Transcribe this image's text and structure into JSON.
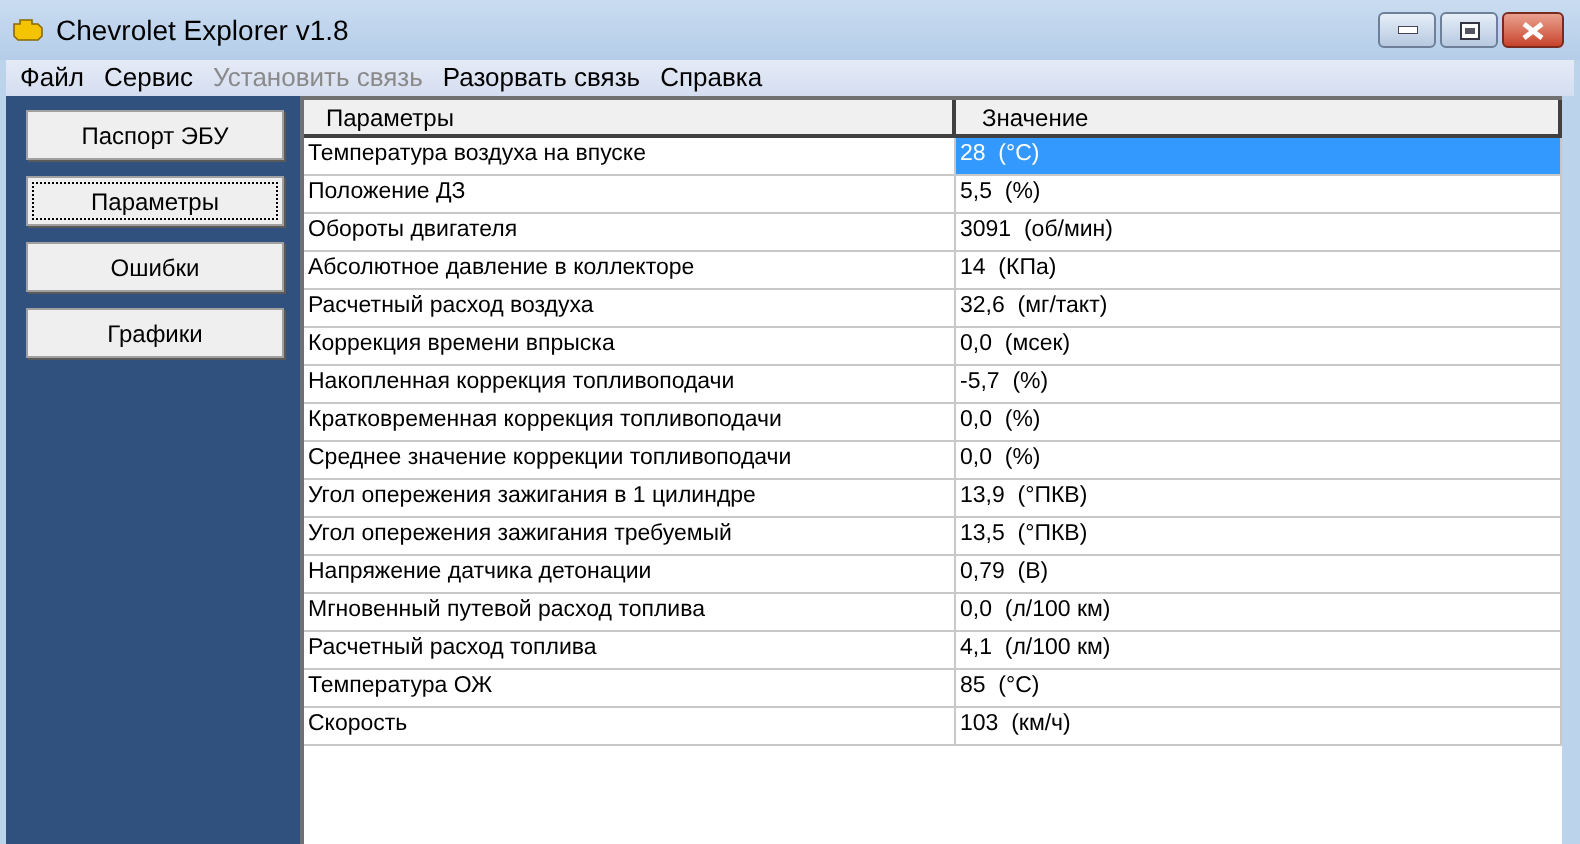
{
  "window": {
    "title": "Chevrolet Explorer v1.8"
  },
  "menu": [
    {
      "label": "Файл",
      "disabled": false
    },
    {
      "label": "Сервис",
      "disabled": false
    },
    {
      "label": "Установить связь",
      "disabled": true
    },
    {
      "label": "Разорвать связь",
      "disabled": false
    },
    {
      "label": "Справка",
      "disabled": false
    }
  ],
  "sidebar": {
    "buttons": [
      {
        "label": "Паспорт ЭБУ",
        "selected": false
      },
      {
        "label": "Параметры",
        "selected": true
      },
      {
        "label": "Ошибки",
        "selected": false
      },
      {
        "label": "Графики",
        "selected": false
      }
    ]
  },
  "table": {
    "columns": [
      "Параметры",
      "Значение"
    ],
    "rows": [
      {
        "cells": [
          "Температура воздуха на впуске",
          "28  (°C)"
        ],
        "selected": true
      },
      {
        "cells": [
          "Положение ДЗ",
          "5,5  (%)"
        ],
        "selected": false
      },
      {
        "cells": [
          "Обороты двигателя",
          "3091  (об/мин)"
        ],
        "selected": false
      },
      {
        "cells": [
          "Абсолютное давление в коллекторе",
          "14  (КПа)"
        ],
        "selected": false
      },
      {
        "cells": [
          "Расчетный расход воздуха",
          "32,6  (мг/такт)"
        ],
        "selected": false
      },
      {
        "cells": [
          "Коррекция времени впрыска",
          "0,0  (мсек)"
        ],
        "selected": false
      },
      {
        "cells": [
          "Накопленная коррекция топливоподачи",
          "-5,7  (%)"
        ],
        "selected": false
      },
      {
        "cells": [
          "Кратковременная коррекция топливоподачи",
          "0,0  (%)"
        ],
        "selected": false
      },
      {
        "cells": [
          "Среднее значение коррекции топливоподачи",
          "0,0  (%)"
        ],
        "selected": false
      },
      {
        "cells": [
          "Угол опережения зажигания в 1 цилиндре",
          "13,9  (°ПКВ)"
        ],
        "selected": false
      },
      {
        "cells": [
          "Угол опережения зажигания требуемый",
          "13,5  (°ПКВ)"
        ],
        "selected": false
      },
      {
        "cells": [
          "Напряжение датчика детонации",
          "0,79  (В)"
        ],
        "selected": false
      },
      {
        "cells": [
          "Мгновенный путевой расход топлива",
          "0,0  (л/100 км)"
        ],
        "selected": false
      },
      {
        "cells": [
          "Расчетный расход топлива",
          "4,1  (л/100 км)"
        ],
        "selected": false
      },
      {
        "cells": [
          "Температура ОЖ",
          "85  (°C)"
        ],
        "selected": false
      },
      {
        "cells": [
          "Скорость",
          "103  (км/ч)"
        ],
        "selected": false
      }
    ]
  }
}
